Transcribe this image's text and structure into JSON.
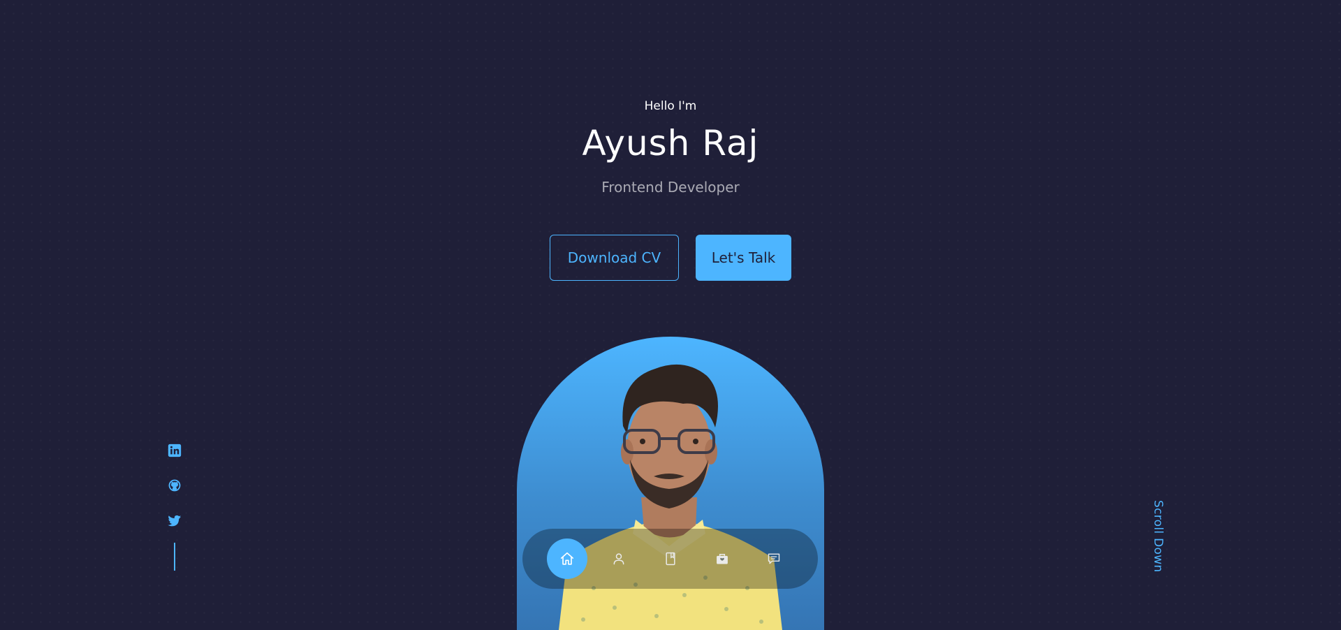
{
  "hero": {
    "greeting": "Hello I'm",
    "name": "Ayush Raj",
    "role": "Frontend Developer"
  },
  "buttons": {
    "download_cv": "Download CV",
    "lets_talk": "Let's Talk"
  },
  "socials": [
    {
      "name": "linkedin-icon"
    },
    {
      "name": "github-icon"
    },
    {
      "name": "twitter-icon"
    }
  ],
  "scroll_down": "Scroll Down",
  "nav": {
    "items": [
      {
        "icon": "home-icon",
        "active": true
      },
      {
        "icon": "user-icon",
        "active": false
      },
      {
        "icon": "book-icon",
        "active": false
      },
      {
        "icon": "briefcase-icon",
        "active": false
      },
      {
        "icon": "message-icon",
        "active": false
      }
    ]
  },
  "colors": {
    "background": "#1f1f38",
    "accent": "#4db5ff",
    "text": "#ffffff",
    "text_muted": "rgba(255,255,255,0.62)"
  }
}
